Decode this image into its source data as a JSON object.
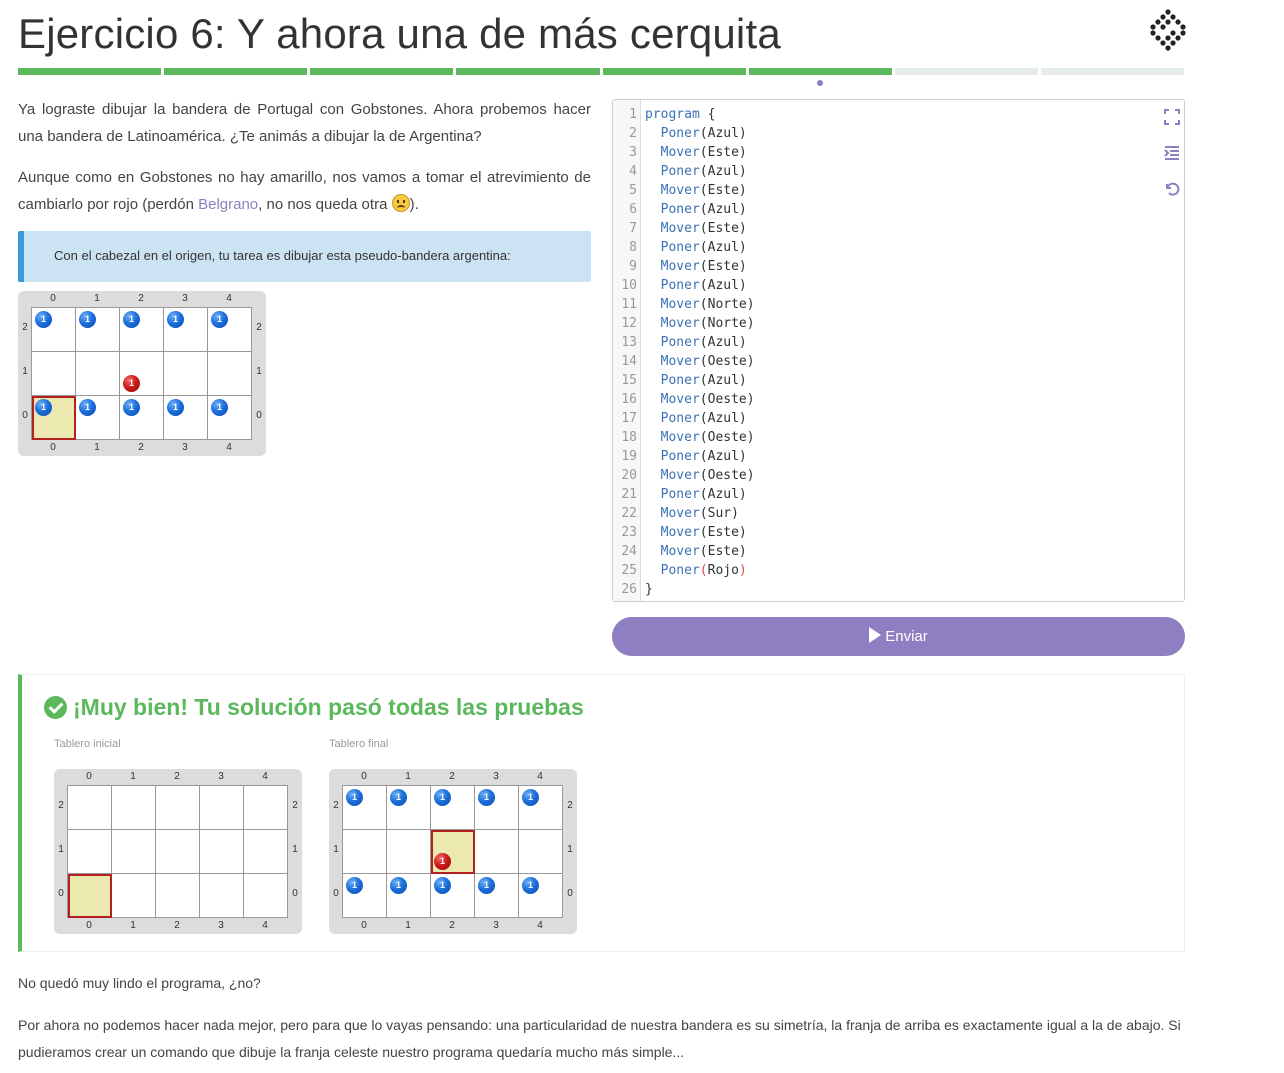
{
  "page": {
    "title": "Ejercicio 6: Y ahora una de más cerquita"
  },
  "progress": {
    "segments_total": 8,
    "segments_done": 6,
    "done_color": "#5cb85c",
    "pending_color": "#e6ebeb"
  },
  "intro": {
    "p1": "Ya lograste dibujar la bandera de Portugal con Gobstones. Ahora probemos hacer una bandera de Latinoamérica. ¿Te animás a dibujar la de Argentina?",
    "p2_before": "Aunque como en Gobstones no hay amarillo, nos vamos a tomar el atrevimiento de cambiarlo por rojo (perdón ",
    "p2_link": "Belgrano",
    "p2_after_a": ", no nos queda otra ",
    "p2_emoji": "frowning-face-icon",
    "p2_after_b": ")."
  },
  "callout": {
    "text": "Con el cabezal en el origen, tu tarea es dibujar esta pseudo-bandera argentina:"
  },
  "boards": {
    "columns": [
      "0",
      "1",
      "2",
      "3",
      "4"
    ],
    "rows": [
      "2",
      "1",
      "0"
    ],
    "ball_count": "1",
    "ball_colors": {
      "blue": "#1d6fdc",
      "red": "#d11a1a"
    },
    "goal": {
      "head": [
        0,
        0
      ],
      "balls": [
        {
          "col": 0,
          "row": 2,
          "color": "blue"
        },
        {
          "col": 1,
          "row": 2,
          "color": "blue"
        },
        {
          "col": 2,
          "row": 2,
          "color": "blue"
        },
        {
          "col": 3,
          "row": 2,
          "color": "blue"
        },
        {
          "col": 4,
          "row": 2,
          "color": "blue"
        },
        {
          "col": 2,
          "row": 1,
          "color": "red"
        },
        {
          "col": 0,
          "row": 0,
          "color": "blue"
        },
        {
          "col": 1,
          "row": 0,
          "color": "blue"
        },
        {
          "col": 2,
          "row": 0,
          "color": "blue"
        },
        {
          "col": 3,
          "row": 0,
          "color": "blue"
        },
        {
          "col": 4,
          "row": 0,
          "color": "blue"
        }
      ]
    },
    "initial": {
      "label": "Tablero inicial",
      "head": [
        0,
        0
      ],
      "balls": []
    },
    "final": {
      "label": "Tablero final",
      "head": [
        2,
        1
      ],
      "balls": [
        {
          "col": 0,
          "row": 2,
          "color": "blue"
        },
        {
          "col": 1,
          "row": 2,
          "color": "blue"
        },
        {
          "col": 2,
          "row": 2,
          "color": "blue"
        },
        {
          "col": 3,
          "row": 2,
          "color": "blue"
        },
        {
          "col": 4,
          "row": 2,
          "color": "blue"
        },
        {
          "col": 2,
          "row": 1,
          "color": "red"
        },
        {
          "col": 0,
          "row": 0,
          "color": "blue"
        },
        {
          "col": 1,
          "row": 0,
          "color": "blue"
        },
        {
          "col": 2,
          "row": 0,
          "color": "blue"
        },
        {
          "col": 3,
          "row": 0,
          "color": "blue"
        },
        {
          "col": 4,
          "row": 0,
          "color": "blue"
        }
      ]
    }
  },
  "editor": {
    "lines": [
      "program {",
      "  Poner(Azul)",
      "  Mover(Este)",
      "  Poner(Azul)",
      "  Mover(Este)",
      "  Poner(Azul)",
      "  Mover(Este)",
      "  Poner(Azul)",
      "  Mover(Este)",
      "  Poner(Azul)",
      "  Mover(Norte)",
      "  Mover(Norte)",
      "  Poner(Azul)",
      "  Mover(Oeste)",
      "  Poner(Azul)",
      "  Mover(Oeste)",
      "  Poner(Azul)",
      "  Mover(Oeste)",
      "  Poner(Azul)",
      "  Mover(Oeste)",
      "  Poner(Azul)",
      "  Mover(Sur)",
      "  Mover(Este)",
      "  Mover(Este)",
      "  Poner(Rojo)",
      "}"
    ],
    "tools": [
      "fullscreen-icon",
      "indent-icon",
      "reset-icon"
    ]
  },
  "submit": {
    "label": "Enviar"
  },
  "result": {
    "title": "¡Muy bien! Tu solución pasó todas las pruebas"
  },
  "outro": {
    "p1": "No quedó muy lindo el programa, ¿no?",
    "p2": "Por ahora no podemos hacer nada mejor, pero para que lo vayas pensando: una particularidad de nuestra bandera es su simetría, la franja de arriba es exactamente igual a la de abajo. Si pudieramos crear un comando que dibuje la franja celeste nuestro programa quedaría mucho más simple..."
  }
}
